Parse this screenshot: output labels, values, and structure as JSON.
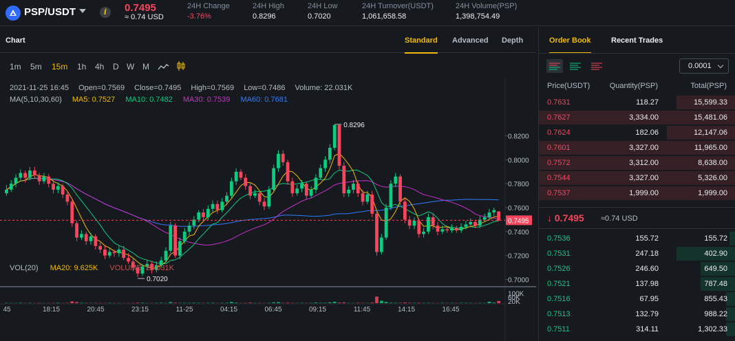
{
  "header": {
    "pair": "PSP/USDT",
    "last_price": "0.7495",
    "last_price_usd": "≈ 0.74 USD",
    "stats": [
      {
        "label": "24H Change",
        "value": "-3.76%"
      },
      {
        "label": "24H High",
        "value": "0.8296"
      },
      {
        "label": "24H Low",
        "value": "0.7020"
      },
      {
        "label": "24H Turnover(USDT)",
        "value": "1,061,658.58"
      },
      {
        "label": "24H Volume(PSP)",
        "value": "1,398,754.49"
      }
    ]
  },
  "chart_panel": {
    "title": "Chart",
    "view_tabs": [
      "Standard",
      "Advanced",
      "Depth"
    ],
    "active_view": "Standard",
    "intervals": [
      "1m",
      "5m",
      "15m",
      "1h",
      "4h",
      "D",
      "W",
      "M"
    ],
    "active_interval": "15m",
    "ohlc": {
      "time": "2021-11-25 16:45",
      "open": "Open=0.7569",
      "close": "Close=0.7495",
      "high": "High=0.7569",
      "low": "Low=0.7486",
      "volume": "Volume: 22.031K"
    },
    "ma": {
      "label": "MA(5,10,30,60)",
      "ma5": "MA5: 0.7527",
      "ma10": "MA10: 0.7482",
      "ma30": "MA30: 0.7539",
      "ma60": "MA60: 0.7681"
    },
    "vol": {
      "label": "VOL(20)",
      "ma20": "MA20: 9.625K",
      "volume": "VOLUME: 22.031K"
    },
    "colors": {
      "up": "#0ecb81",
      "down": "#f6465d",
      "ma5": "#f0b90b",
      "ma10": "#0ecb81",
      "ma30": "#c931c9",
      "ma60": "#2f7bff"
    }
  },
  "chart_data": {
    "type": "candlestick",
    "price_axis": {
      "ticks": [
        "0.8200",
        "0.8000",
        "0.7800",
        "0.7600",
        "0.7400",
        "0.7200",
        "0.7000"
      ],
      "range": [
        0.694,
        0.845
      ]
    },
    "volume_axis": {
      "ticks": [
        "100K",
        "60K",
        "20K"
      ],
      "range": [
        0,
        130
      ]
    },
    "time_ticks": [
      "45",
      "18:15",
      "20:45",
      "23:15",
      "11-25",
      "04:15",
      "06:45",
      "09:15",
      "11:45",
      "14:15",
      "16:45"
    ],
    "last_price_tag": "0.7495",
    "high_marker": "0.8296",
    "low_marker": "0.7020",
    "ohlc": [
      [
        0.772,
        0.775,
        0.779,
        0.77
      ],
      [
        0.775,
        0.78,
        0.783,
        0.773
      ],
      [
        0.78,
        0.785,
        0.788,
        0.777
      ],
      [
        0.785,
        0.789,
        0.792,
        0.782
      ],
      [
        0.789,
        0.785,
        0.791,
        0.781
      ],
      [
        0.785,
        0.791,
        0.794,
        0.783
      ],
      [
        0.791,
        0.787,
        0.794,
        0.784
      ],
      [
        0.787,
        0.782,
        0.789,
        0.779
      ],
      [
        0.782,
        0.786,
        0.789,
        0.78
      ],
      [
        0.786,
        0.78,
        0.788,
        0.777
      ],
      [
        0.78,
        0.775,
        0.782,
        0.772
      ],
      [
        0.775,
        0.778,
        0.781,
        0.772
      ],
      [
        0.778,
        0.771,
        0.78,
        0.768
      ],
      [
        0.771,
        0.765,
        0.774,
        0.762
      ],
      [
        0.765,
        0.747,
        0.768,
        0.744
      ],
      [
        0.747,
        0.735,
        0.749,
        0.732
      ],
      [
        0.735,
        0.738,
        0.741,
        0.733
      ],
      [
        0.738,
        0.732,
        0.74,
        0.729
      ],
      [
        0.732,
        0.736,
        0.739,
        0.729
      ],
      [
        0.736,
        0.728,
        0.738,
        0.725
      ],
      [
        0.728,
        0.725,
        0.731,
        0.722
      ],
      [
        0.725,
        0.72,
        0.728,
        0.717
      ],
      [
        0.72,
        0.723,
        0.726,
        0.718
      ],
      [
        0.723,
        0.722,
        0.725,
        0.719
      ],
      [
        0.722,
        0.725,
        0.728,
        0.719
      ],
      [
        0.725,
        0.718,
        0.728,
        0.716
      ],
      [
        0.718,
        0.715,
        0.722,
        0.713
      ],
      [
        0.715,
        0.71,
        0.718,
        0.707
      ],
      [
        0.71,
        0.705,
        0.712,
        0.702
      ],
      [
        0.705,
        0.711,
        0.713,
        0.703
      ],
      [
        0.711,
        0.713,
        0.716,
        0.708
      ],
      [
        0.713,
        0.708,
        0.715,
        0.705
      ],
      [
        0.708,
        0.712,
        0.715,
        0.706
      ],
      [
        0.712,
        0.716,
        0.719,
        0.71
      ],
      [
        0.716,
        0.724,
        0.727,
        0.714
      ],
      [
        0.724,
        0.745,
        0.748,
        0.722
      ],
      [
        0.745,
        0.72,
        0.747,
        0.718
      ],
      [
        0.72,
        0.732,
        0.735,
        0.717
      ],
      [
        0.732,
        0.74,
        0.743,
        0.73
      ],
      [
        0.74,
        0.745,
        0.748,
        0.737
      ],
      [
        0.745,
        0.75,
        0.753,
        0.742
      ],
      [
        0.75,
        0.756,
        0.758,
        0.748
      ],
      [
        0.756,
        0.752,
        0.759,
        0.749
      ],
      [
        0.752,
        0.759,
        0.762,
        0.75
      ],
      [
        0.759,
        0.763,
        0.766,
        0.756
      ],
      [
        0.763,
        0.758,
        0.766,
        0.755
      ],
      [
        0.758,
        0.765,
        0.768,
        0.756
      ],
      [
        0.765,
        0.77,
        0.773,
        0.762
      ],
      [
        0.77,
        0.782,
        0.785,
        0.768
      ],
      [
        0.782,
        0.79,
        0.793,
        0.779
      ],
      [
        0.79,
        0.785,
        0.792,
        0.783
      ],
      [
        0.785,
        0.778,
        0.788,
        0.775
      ],
      [
        0.778,
        0.77,
        0.781,
        0.767
      ],
      [
        0.77,
        0.772,
        0.775,
        0.768
      ],
      [
        0.772,
        0.765,
        0.774,
        0.762
      ],
      [
        0.765,
        0.761,
        0.768,
        0.758
      ],
      [
        0.761,
        0.775,
        0.778,
        0.759
      ],
      [
        0.775,
        0.793,
        0.796,
        0.773
      ],
      [
        0.793,
        0.805,
        0.808,
        0.79
      ],
      [
        0.805,
        0.798,
        0.808,
        0.795
      ],
      [
        0.798,
        0.782,
        0.8,
        0.779
      ],
      [
        0.782,
        0.772,
        0.785,
        0.769
      ],
      [
        0.772,
        0.776,
        0.779,
        0.77
      ],
      [
        0.776,
        0.78,
        0.783,
        0.773
      ],
      [
        0.78,
        0.77,
        0.782,
        0.767
      ],
      [
        0.77,
        0.775,
        0.778,
        0.768
      ],
      [
        0.775,
        0.785,
        0.788,
        0.772
      ],
      [
        0.785,
        0.793,
        0.796,
        0.783
      ],
      [
        0.793,
        0.8,
        0.803,
        0.79
      ],
      [
        0.8,
        0.81,
        0.813,
        0.797
      ],
      [
        0.81,
        0.829,
        0.8296,
        0.808
      ],
      [
        0.829,
        0.795,
        0.8296,
        0.792
      ],
      [
        0.795,
        0.772,
        0.798,
        0.769
      ],
      [
        0.772,
        0.775,
        0.778,
        0.769
      ],
      [
        0.775,
        0.78,
        0.783,
        0.772
      ],
      [
        0.78,
        0.772,
        0.782,
        0.769
      ],
      [
        0.772,
        0.765,
        0.775,
        0.762
      ],
      [
        0.765,
        0.771,
        0.774,
        0.763
      ],
      [
        0.771,
        0.755,
        0.774,
        0.752
      ],
      [
        0.755,
        0.723,
        0.757,
        0.72
      ],
      [
        0.723,
        0.735,
        0.738,
        0.721
      ],
      [
        0.735,
        0.76,
        0.763,
        0.733
      ],
      [
        0.76,
        0.78,
        0.783,
        0.758
      ],
      [
        0.78,
        0.786,
        0.789,
        0.777
      ],
      [
        0.786,
        0.765,
        0.788,
        0.762
      ],
      [
        0.765,
        0.75,
        0.768,
        0.747
      ],
      [
        0.75,
        0.745,
        0.753,
        0.742
      ],
      [
        0.745,
        0.749,
        0.752,
        0.742
      ],
      [
        0.749,
        0.738,
        0.751,
        0.735
      ],
      [
        0.738,
        0.74,
        0.743,
        0.735
      ],
      [
        0.74,
        0.752,
        0.755,
        0.738
      ],
      [
        0.752,
        0.745,
        0.755,
        0.742
      ],
      [
        0.745,
        0.74,
        0.748,
        0.737
      ],
      [
        0.74,
        0.742,
        0.745,
        0.738
      ],
      [
        0.742,
        0.741,
        0.744,
        0.739
      ],
      [
        0.741,
        0.743,
        0.746,
        0.739
      ],
      [
        0.743,
        0.741,
        0.745,
        0.739
      ],
      [
        0.741,
        0.744,
        0.747,
        0.739
      ],
      [
        0.744,
        0.746,
        0.749,
        0.742
      ],
      [
        0.746,
        0.748,
        0.751,
        0.744
      ],
      [
        0.748,
        0.745,
        0.75,
        0.743
      ],
      [
        0.745,
        0.75,
        0.753,
        0.743
      ],
      [
        0.75,
        0.752,
        0.755,
        0.748
      ],
      [
        0.752,
        0.756,
        0.759,
        0.75
      ],
      [
        0.756,
        0.758,
        0.76,
        0.753
      ],
      [
        0.7569,
        0.7495,
        0.7569,
        0.7486
      ]
    ],
    "volume": [
      3,
      2,
      2,
      4,
      2,
      3,
      2,
      3,
      2,
      2,
      3,
      4,
      2,
      3,
      18,
      11,
      4,
      3,
      2,
      3,
      2,
      2,
      3,
      2,
      2,
      2,
      2,
      3,
      5,
      4,
      2,
      2,
      3,
      4,
      2,
      11,
      5,
      3,
      3,
      3,
      4,
      3,
      2,
      3,
      4,
      2,
      3,
      4,
      12,
      5,
      2,
      3,
      6,
      2,
      3,
      2,
      3,
      8,
      10,
      3,
      5,
      3,
      2,
      3,
      2,
      3,
      6,
      4,
      4,
      8,
      14,
      6,
      8,
      2,
      2,
      4,
      3,
      2,
      6,
      66,
      24,
      12,
      5,
      4,
      3,
      7,
      4,
      3,
      4,
      2,
      3,
      2,
      2,
      3,
      2,
      3,
      2,
      3,
      3,
      3,
      2,
      3,
      2,
      15,
      6,
      22
    ]
  },
  "order_book": {
    "tabs": [
      "Order Book",
      "Recent Trades"
    ],
    "active_tab": "Order Book",
    "precision": "0.0001",
    "columns": [
      "Price(USDT)",
      "Quantity(PSP)",
      "Total(PSP)"
    ],
    "asks": [
      {
        "price": "0.7631",
        "qty": "118.27",
        "total": "15,599.33",
        "depth": 0.3
      },
      {
        "price": "0.7627",
        "qty": "3,334.00",
        "total": "15,481.06",
        "depth": 1.0
      },
      {
        "price": "0.7624",
        "qty": "182.06",
        "total": "12,147.06",
        "depth": 0.35
      },
      {
        "price": "0.7601",
        "qty": "3,327.00",
        "total": "11,965.00",
        "depth": 1.0
      },
      {
        "price": "0.7572",
        "qty": "3,312.00",
        "total": "8,638.00",
        "depth": 1.0
      },
      {
        "price": "0.7544",
        "qty": "3,327.00",
        "total": "5,326.00",
        "depth": 1.0
      },
      {
        "price": "0.7537",
        "qty": "1,999.00",
        "total": "1,999.00",
        "depth": 1.0
      }
    ],
    "mid_price": "↓ 0.7495",
    "mid_usd": "≈0.74 USD",
    "bids": [
      {
        "price": "0.7536",
        "qty": "155.72",
        "total": "155.72",
        "depth": 0.03
      },
      {
        "price": "0.7531",
        "qty": "247.18",
        "total": "402.90",
        "depth": 0.3
      },
      {
        "price": "0.7526",
        "qty": "246.60",
        "total": "649.50",
        "depth": 0.18
      },
      {
        "price": "0.7521",
        "qty": "137.98",
        "total": "787.48",
        "depth": 0.18
      },
      {
        "price": "0.7516",
        "qty": "67.95",
        "total": "855.43",
        "depth": 0.05
      },
      {
        "price": "0.7513",
        "qty": "132.79",
        "total": "988.22",
        "depth": 0.05
      },
      {
        "price": "0.7511",
        "qty": "314.11",
        "total": "1,302.33",
        "depth": 0.05
      }
    ]
  }
}
